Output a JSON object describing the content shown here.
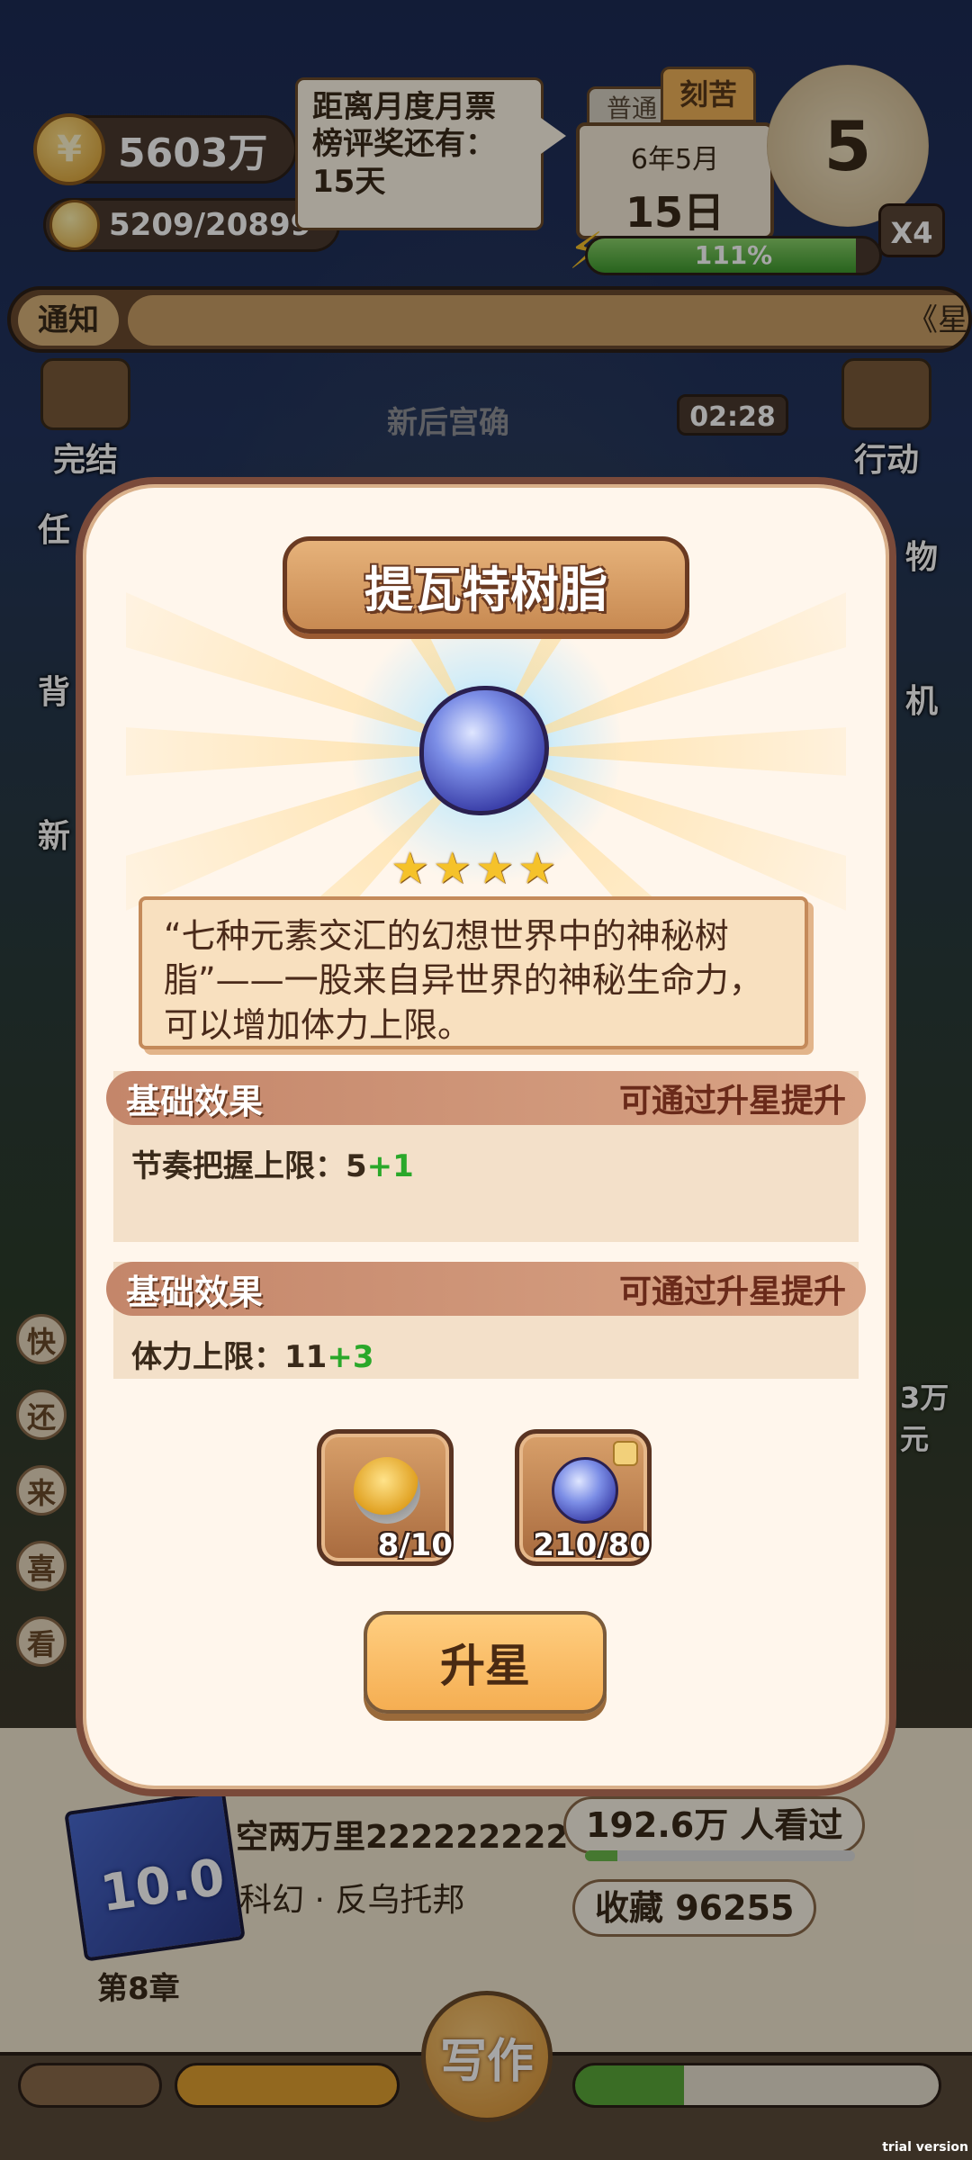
{
  "hud": {
    "coins": "5603万",
    "energy": "5209/20899",
    "tooltip_lines": [
      "距离月度月票",
      "榜评奖还有：",
      "15天"
    ],
    "tab_normal": "普通",
    "tab_hard": "刻苦",
    "date_month": "6年5月",
    "date_day": "15日",
    "clock_value": "5",
    "multiplier": "X4",
    "stamina_text": "111%",
    "stamina_fill_fraction": 0.92
  },
  "notice": {
    "label": "通知",
    "text": "《星"
  },
  "scene": {
    "side_left": [
      "完结",
      "任",
      "背",
      "新"
    ],
    "side_right": [
      "行动",
      "物",
      "机"
    ],
    "timer": "02:28",
    "house_label": "新后宫确",
    "left_pills": [
      "快",
      "还",
      "来",
      "喜",
      "看"
    ],
    "right_money": "3万元"
  },
  "modal": {
    "title": "提瓦特树脂",
    "stars": 4,
    "description": "“七种元素交汇的幻想世界中的神秘树脂”——一股来自异世界的神秘生命力，可以增加体力上限。",
    "effects": [
      {
        "header": "基础效果",
        "hint": "可通过升星提升",
        "label": "节奏把握上限：",
        "value": "5",
        "bonus": "+1"
      },
      {
        "header": "基础效果",
        "hint": "可通过升星提升",
        "label": "体力上限：",
        "value": "11",
        "bonus": "+3"
      }
    ],
    "materials": [
      {
        "icon": "golden-finger-icon",
        "count": "8/10"
      },
      {
        "icon": "resin-icon",
        "count": "210/80"
      }
    ],
    "upgrade_label": "升星"
  },
  "book": {
    "score": "10.0",
    "title": "空两万里222222222",
    "genre": "科幻 · 反乌托邦",
    "chapter": "第8章",
    "views": "192.6万 人看过",
    "favorites": "收藏 96255",
    "views_fill_fraction": 0.12
  },
  "bottom": {
    "write_label": "写作"
  },
  "watermark": "trial version"
}
